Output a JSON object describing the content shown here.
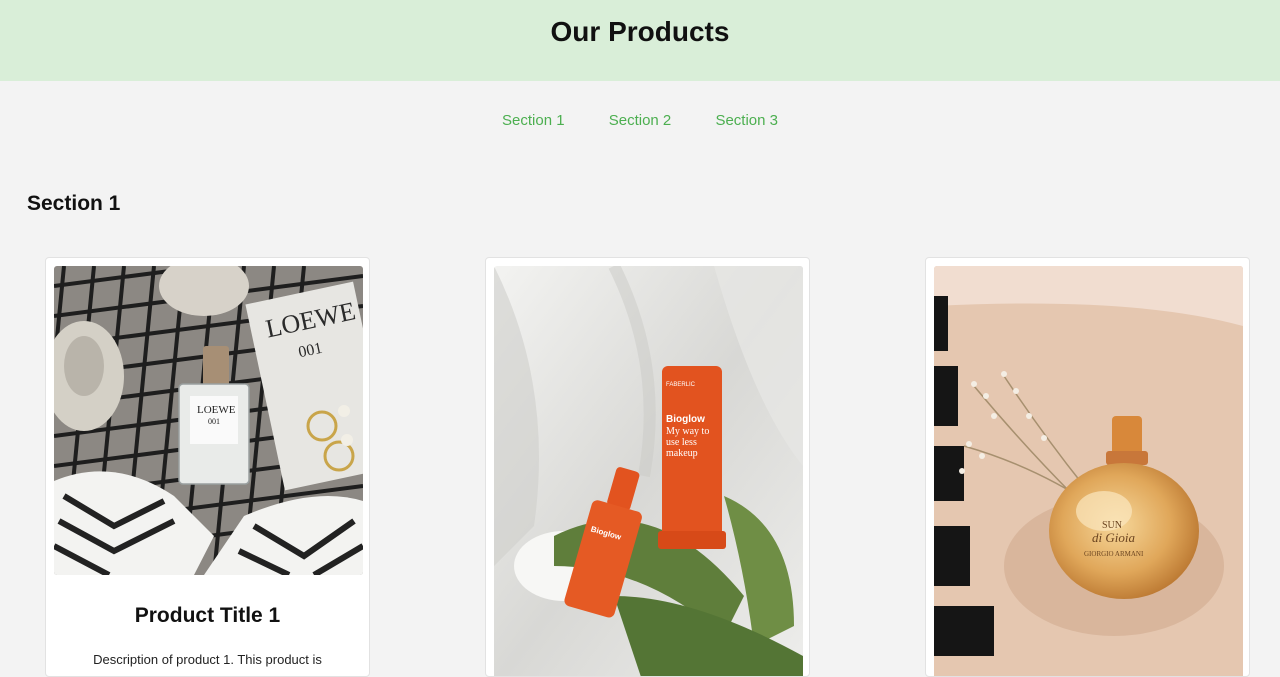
{
  "header": {
    "title": "Our Products"
  },
  "nav": {
    "items": [
      "Section 1",
      "Section 2",
      "Section 3"
    ]
  },
  "section": {
    "title": "Section 1",
    "cards": [
      {
        "title": "Product Title 1",
        "description": "Description of product 1. This product is",
        "image": "perfume-flatlay-image"
      },
      {
        "title": "",
        "description": "",
        "image": "bioglow-skincare-image"
      },
      {
        "title": "",
        "description": "",
        "image": "amber-perfume-bottle-image"
      }
    ]
  }
}
